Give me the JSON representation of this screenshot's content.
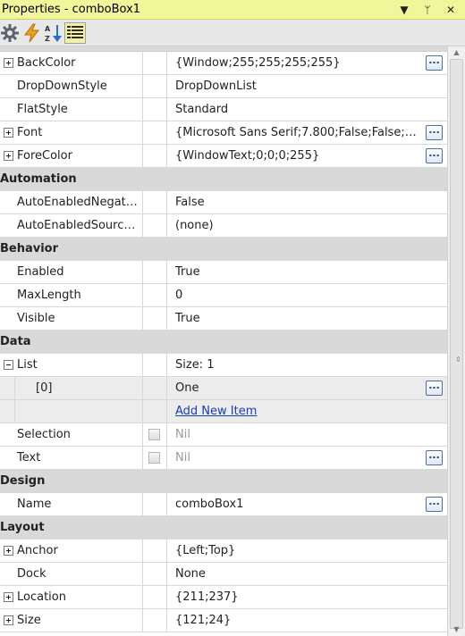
{
  "window": {
    "title": "Properties - comboBox1",
    "buttons": {
      "dropdown": "▼",
      "pin": "ᛘ",
      "close": "✕"
    }
  },
  "toolbar": {
    "tools": [
      {
        "name": "properties-icon",
        "active": false
      },
      {
        "name": "events-icon",
        "active": false
      },
      {
        "name": "alphabetical-sort-icon",
        "active": false
      },
      {
        "name": "categorized-icon",
        "active": true
      }
    ]
  },
  "grid": {
    "rows": [
      {
        "kind": "prop",
        "name": "BackColor",
        "value": "{Window;255;255;255;255}",
        "expander": "plus",
        "ellipsis": true
      },
      {
        "kind": "prop",
        "name": "DropDownStyle",
        "value": "DropDownList"
      },
      {
        "kind": "prop",
        "name": "FlatStyle",
        "value": "Standard"
      },
      {
        "kind": "prop",
        "name": "Font",
        "value": "{Microsoft Sans Serif;7.800;False;False;Fals...",
        "expander": "plus",
        "ellipsis": true
      },
      {
        "kind": "prop",
        "name": "ForeColor",
        "value": "{WindowText;0;0;0;255}",
        "expander": "plus",
        "ellipsis": true
      },
      {
        "kind": "cat",
        "name": "Automation"
      },
      {
        "kind": "prop",
        "name": "AutoEnabledNegate ...",
        "value": "False"
      },
      {
        "kind": "prop",
        "name": "AutoEnabledSource ...",
        "value": "(none)"
      },
      {
        "kind": "cat",
        "name": "Behavior"
      },
      {
        "kind": "prop",
        "name": "Enabled",
        "value": "True"
      },
      {
        "kind": "prop",
        "name": "MaxLength",
        "value": "0"
      },
      {
        "kind": "prop",
        "name": "Visible",
        "value": "True"
      },
      {
        "kind": "cat",
        "name": "Data"
      },
      {
        "kind": "prop",
        "name": "List",
        "value": "Size: 1",
        "expander": "minus"
      },
      {
        "kind": "sub",
        "name": "[0]",
        "value": "One",
        "ellipsis": true,
        "selected": true
      },
      {
        "kind": "sub",
        "name": "",
        "value": "Add New Item",
        "link": true,
        "selected": true
      },
      {
        "kind": "prop",
        "name": "Selection",
        "value": "Nil",
        "checkbox": true,
        "gray": true
      },
      {
        "kind": "prop",
        "name": "Text",
        "value": "Nil",
        "checkbox": true,
        "gray": true,
        "ellipsis": true
      },
      {
        "kind": "cat",
        "name": "Design"
      },
      {
        "kind": "prop",
        "name": "Name",
        "value": "comboBox1",
        "ellipsis": true
      },
      {
        "kind": "cat",
        "name": "Layout"
      },
      {
        "kind": "prop",
        "name": "Anchor",
        "value": "{Left;Top}",
        "expander": "plus"
      },
      {
        "kind": "prop",
        "name": "Dock",
        "value": "None"
      },
      {
        "kind": "prop",
        "name": "Location",
        "value": "{211;237}",
        "expander": "plus"
      },
      {
        "kind": "prop",
        "name": "Size",
        "value": "{121;24}",
        "expander": "plus"
      }
    ],
    "ellipsis_label": "..."
  },
  "scrollbar": {
    "up": "▲",
    "down": "▼",
    "grip": "⇕"
  },
  "colors": {
    "title_bg": "#f0f69a",
    "category_bg": "#d9d9d9",
    "link": "#1a3fb0"
  }
}
